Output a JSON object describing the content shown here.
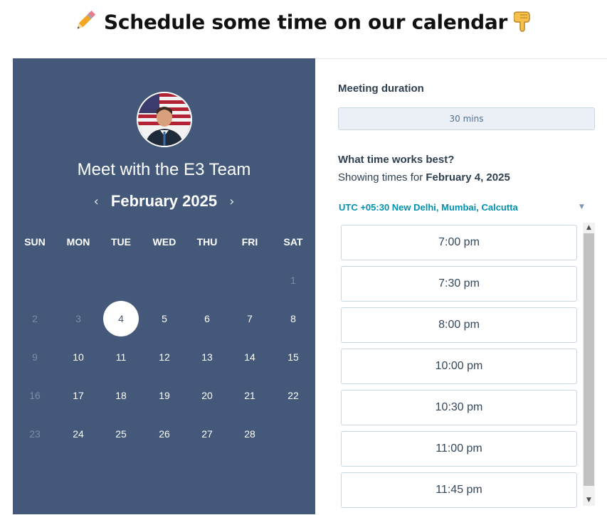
{
  "heading": {
    "text": "Schedule some time on our calendar"
  },
  "left": {
    "meet_title": "Meet with the E3 Team",
    "month": "February 2025",
    "dow": [
      "SUN",
      "MON",
      "TUE",
      "WED",
      "THU",
      "FRI",
      "SAT"
    ],
    "days": [
      {
        "n": "1",
        "muted": true
      },
      {
        "n": "2",
        "muted": true
      },
      {
        "n": "3",
        "muted": true
      },
      {
        "n": "4",
        "selected": true
      },
      {
        "n": "5"
      },
      {
        "n": "6"
      },
      {
        "n": "7"
      },
      {
        "n": "8"
      },
      {
        "n": "9",
        "muted": true
      },
      {
        "n": "10"
      },
      {
        "n": "11"
      },
      {
        "n": "12"
      },
      {
        "n": "13"
      },
      {
        "n": "14"
      },
      {
        "n": "15"
      },
      {
        "n": "16",
        "muted": true
      },
      {
        "n": "17"
      },
      {
        "n": "18"
      },
      {
        "n": "19"
      },
      {
        "n": "20"
      },
      {
        "n": "21"
      },
      {
        "n": "22"
      },
      {
        "n": "23",
        "muted": true
      },
      {
        "n": "24"
      },
      {
        "n": "25"
      },
      {
        "n": "26"
      },
      {
        "n": "27"
      },
      {
        "n": "28"
      }
    ]
  },
  "right": {
    "duration_label": "Meeting duration",
    "duration_value": "30 mins",
    "time_question": "What time works best?",
    "showing_prefix": "Showing times for",
    "showing_date": "February 4, 2025",
    "timezone": "UTC +05:30 New Delhi, Mumbai, Calcutta",
    "slots": [
      "7:00 pm",
      "7:30 pm",
      "8:00 pm",
      "10:00 pm",
      "10:30 pm",
      "11:00 pm",
      "11:45 pm"
    ]
  },
  "colors": {
    "panel": "#44597a",
    "accent": "#0091ae"
  },
  "icons": {
    "pencil": "pencil-icon",
    "hand": "pointing-down-hand-icon",
    "prev": "chevron-left-icon",
    "next": "chevron-right-icon",
    "caret": "caret-down-icon"
  }
}
